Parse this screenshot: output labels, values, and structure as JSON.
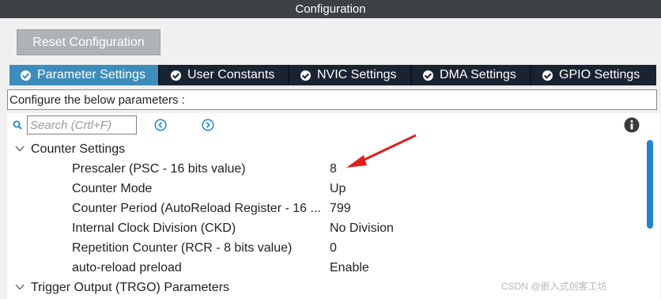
{
  "window": {
    "title": "Configuration"
  },
  "toolbar": {
    "reset_label": "Reset Configuration"
  },
  "tabs": [
    {
      "label": "Parameter Settings",
      "active": true,
      "icon": "check-circle-icon"
    },
    {
      "label": "User Constants",
      "active": false,
      "icon": "check-circle-icon"
    },
    {
      "label": "NVIC Settings",
      "active": false,
      "icon": "check-circle-icon"
    },
    {
      "label": "DMA Settings",
      "active": false,
      "icon": "check-circle-icon"
    },
    {
      "label": "GPIO Settings",
      "active": false,
      "icon": "check-circle-icon"
    }
  ],
  "description": "Configure the below parameters :",
  "search": {
    "placeholder": "Search (Crtl+F)",
    "value": ""
  },
  "groups": [
    {
      "label": "Counter Settings",
      "expanded": true,
      "params": [
        {
          "name": "Prescaler (PSC - 16 bits value)",
          "value": "8"
        },
        {
          "name": "Counter Mode",
          "value": "Up"
        },
        {
          "name": "Counter Period (AutoReload Register - 16 ...",
          "value": "799"
        },
        {
          "name": "Internal Clock Division (CKD)",
          "value": "No Division"
        },
        {
          "name": "Repetition Counter (RCR - 8 bits value)",
          "value": "0"
        },
        {
          "name": "auto-reload preload",
          "value": "Enable"
        }
      ]
    },
    {
      "label": "Trigger Output (TRGO) Parameters",
      "expanded": true,
      "params": []
    }
  ],
  "watermark": "CSDN @嵌入式创客工坊",
  "colors": {
    "titlebar": "#3c4146",
    "tab_bar": "#1a2330",
    "tab_active": "#3c8dbc",
    "accent": "#1f86d6",
    "annotation_arrow": "#e02020"
  }
}
